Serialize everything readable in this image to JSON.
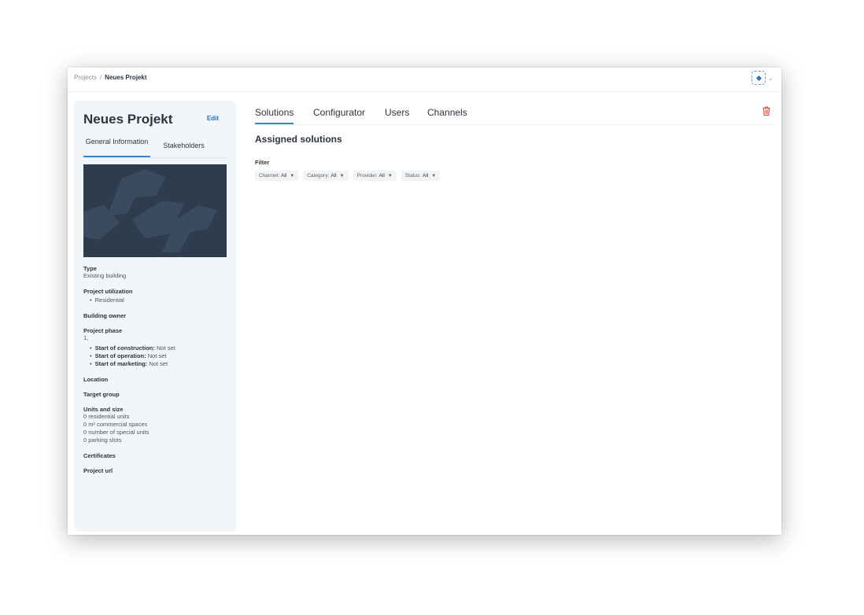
{
  "breadcrumb": {
    "root": "Projects",
    "separator": "/",
    "current": "Neues Projekt"
  },
  "user_menu": {
    "icon": "app-logo-icon",
    "chevron": "chevron-down-icon"
  },
  "sidebar": {
    "title": "Neues Projekt",
    "edit_label": "Edit",
    "tabs": [
      {
        "label": "General Information",
        "active": true
      },
      {
        "label": "Stakeholders",
        "active": false
      }
    ],
    "type_label": "Type",
    "type_value": "Existing building",
    "utilization_label": "Project utilization",
    "utilization_items": [
      "Residential"
    ],
    "owner_label": "Building owner",
    "phase_label": "Project phase",
    "phase_value": "1,",
    "phase_items": [
      {
        "key": "Start of construction:",
        "value": "Not set"
      },
      {
        "key": "Start of operation:",
        "value": "Not set"
      },
      {
        "key": "Start of marketing:",
        "value": "Not set"
      }
    ],
    "location_label": "Location",
    "target_label": "Target group",
    "units_label": "Units and size",
    "units": [
      "0  residential units",
      "0 m²  commercial spaces",
      "0  number of special units",
      "0  parking slots"
    ],
    "certificates_label": "Certificates",
    "url_label": "Project url"
  },
  "main": {
    "tabs": [
      {
        "label": "Solutions",
        "active": true
      },
      {
        "label": "Configurator",
        "active": false
      },
      {
        "label": "Users",
        "active": false
      },
      {
        "label": "Channels",
        "active": false
      }
    ],
    "delete_icon": "trash-icon",
    "section_title": "Assigned solutions",
    "filter_label": "Filter",
    "filters": [
      {
        "name": "Channel:",
        "value": "All"
      },
      {
        "name": "Category:",
        "value": "All"
      },
      {
        "name": "Provider:",
        "value": "All"
      },
      {
        "name": "Status:",
        "value": "All"
      }
    ]
  },
  "colors": {
    "accent": "#3a84c9",
    "link": "#1a73c7",
    "danger": "#e0443a",
    "sidebar_bg": "#f3f6f9",
    "image_bg": "#2f3c4e"
  }
}
